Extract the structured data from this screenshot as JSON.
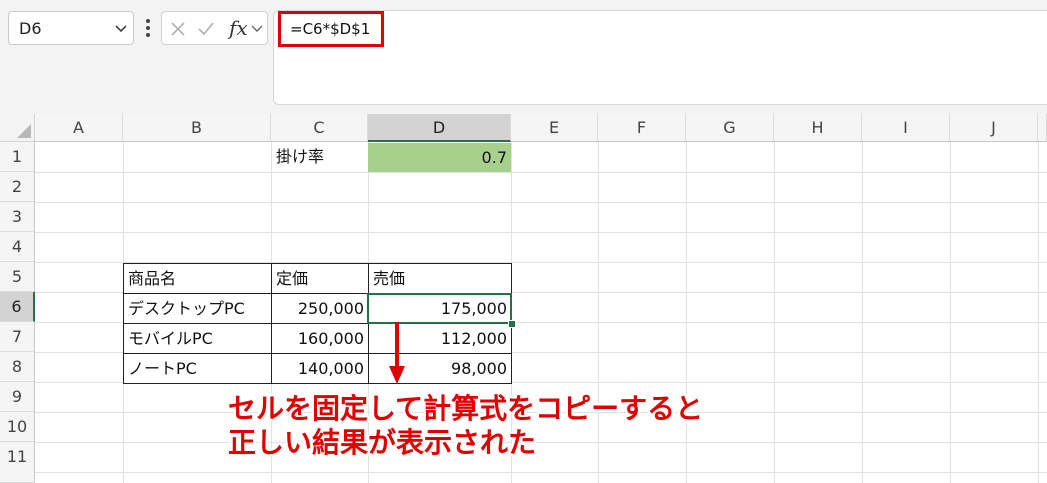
{
  "name_box": {
    "value": "D6"
  },
  "formula_bar": {
    "fx_label": "fx",
    "formula": "=C6*$D$1"
  },
  "columns": [
    "A",
    "B",
    "C",
    "D",
    "E",
    "F",
    "G",
    "H",
    "I",
    "J"
  ],
  "rows": [
    "1",
    "2",
    "3",
    "4",
    "5",
    "6",
    "7",
    "8",
    "9",
    "10",
    "11"
  ],
  "cells": {
    "C1": "掛け率",
    "D1": "0.7"
  },
  "table": {
    "headers": [
      "商品名",
      "定価",
      "売価"
    ],
    "rows": [
      [
        "デスクトップPC",
        "250,000",
        "175,000"
      ],
      [
        "モバイルPC",
        "160,000",
        "112,000"
      ],
      [
        "ノートPC",
        "140,000",
        "98,000"
      ]
    ]
  },
  "annotation": {
    "line1": "セルを固定して計算式をコピーすると",
    "line2": "正しい結果が表示された"
  },
  "colors": {
    "accent_green": "#217346",
    "highlight_red": "#e00000",
    "rate_fill": "#a8d08d"
  }
}
